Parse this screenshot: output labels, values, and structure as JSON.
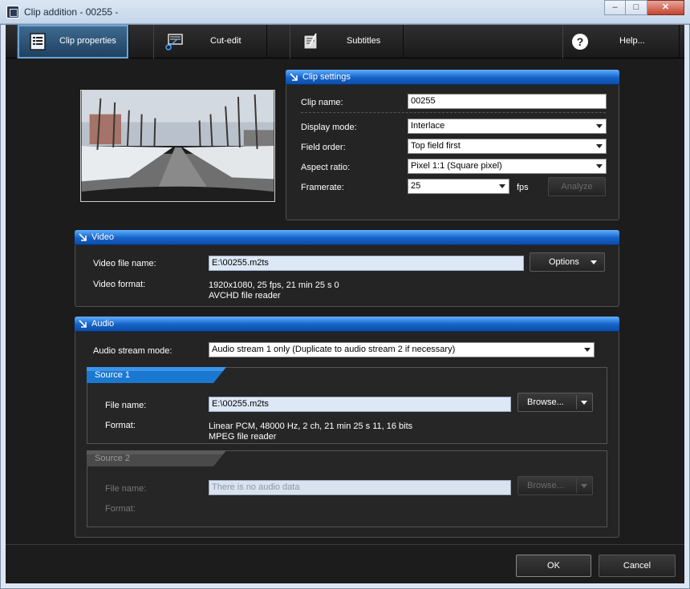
{
  "window": {
    "title": "Clip addition - 00255 -",
    "minimize": "–",
    "maximize": "□",
    "close": "✕"
  },
  "toolbar": {
    "tabs": [
      {
        "label": "Clip properties",
        "icon": "clip-properties-icon",
        "active": true
      },
      {
        "label": "Cut-edit",
        "icon": "cut-edit-icon",
        "active": false
      },
      {
        "label": "Subtitles",
        "icon": "subtitles-icon",
        "active": false
      },
      {
        "label": "Help...",
        "icon": "help-icon",
        "active": false
      }
    ]
  },
  "clip_settings": {
    "title": "Clip settings",
    "clip_name_label": "Clip name:",
    "clip_name_value": "00255",
    "display_mode_label": "Display mode:",
    "display_mode_value": "Interlace",
    "field_order_label": "Field order:",
    "field_order_value": "Top field first",
    "aspect_ratio_label": "Aspect ratio:",
    "aspect_ratio_value": "Pixel 1:1 (Square pixel)",
    "framerate_label": "Framerate:",
    "framerate_value": "25",
    "fps_unit": "fps",
    "analyze_button": "Analyze"
  },
  "video": {
    "title": "Video",
    "file_name_label": "Video file name:",
    "file_name_value": "E:\\00255.m2ts",
    "options_button": "Options",
    "format_label": "Video format:",
    "format_line1": "1920x1080,  25  fps,  21 min 25 s 0",
    "format_line2": "AVCHD file reader"
  },
  "audio": {
    "title": "Audio",
    "stream_mode_label": "Audio stream mode:",
    "stream_mode_value": "Audio stream 1 only (Duplicate to audio stream 2 if necessary)",
    "source1": {
      "title": "Source 1",
      "file_name_label": "File name:",
      "file_name_value": "E:\\00255.m2ts",
      "browse_button": "Browse...",
      "format_label": "Format:",
      "format_line1": "Linear PCM,  48000  Hz,  2  ch,  21 min 25 s 11,  16  bits",
      "format_line2": "MPEG file reader"
    },
    "source2": {
      "title": "Source 2",
      "file_name_label": "File name:",
      "file_name_value": "There is no audio data",
      "browse_button": "Browse...",
      "format_label": "Format:"
    }
  },
  "footer": {
    "ok_button": "OK",
    "cancel_button": "Cancel"
  },
  "colors": {
    "accent": "#1662c8",
    "panel_bg": "#242424",
    "window_bg": "#1c1c1c"
  }
}
